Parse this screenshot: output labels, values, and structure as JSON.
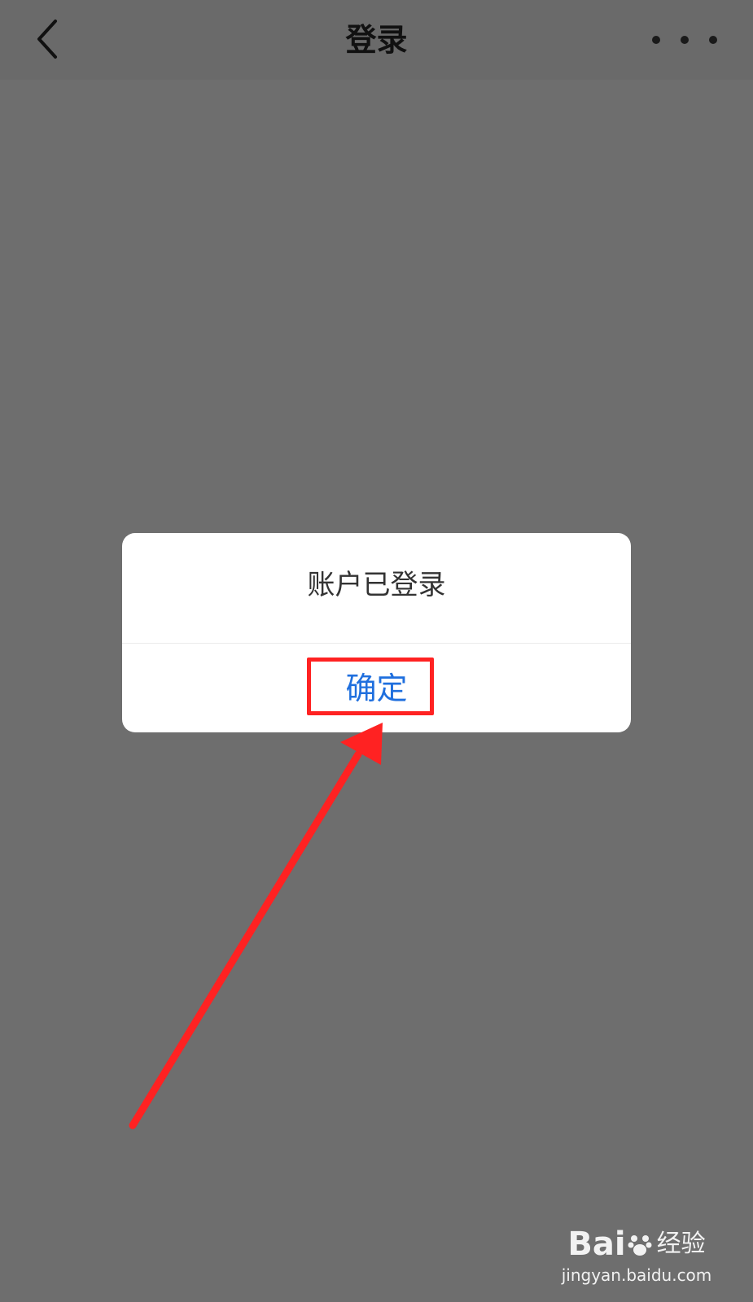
{
  "nav": {
    "title": "登录",
    "back_icon": "chevron-left-icon",
    "more_icon": "more-horizontal-icon"
  },
  "dialog": {
    "message": "账户已登录",
    "confirm_label": "确定"
  },
  "watermark": {
    "logo_prefix": "Bai",
    "logo_suffix": "经验",
    "logo_paw_icon": "baidu-paw-icon",
    "url": "jingyan.baidu.com"
  },
  "annotation": {
    "color": "#ff2222"
  },
  "colors": {
    "overlay": "#6e6e6e",
    "confirm_text": "#1f6fde",
    "message_text": "#333333"
  }
}
